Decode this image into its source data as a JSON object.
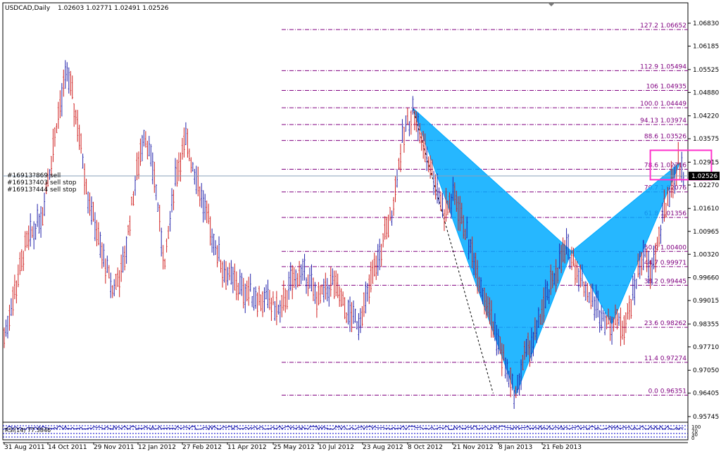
{
  "header": {
    "symbol_label": "USDCAD,Daily",
    "ohlc_text": "1.02603 1.02771 1.02491 1.02526"
  },
  "orders": [
    "#16913?869 sell",
    "#16913?403 sell stop",
    "#16913?444 sell stop"
  ],
  "indicator": {
    "label": "RSI(14) 77.3846",
    "level_labels": [
      "100",
      "70",
      "30",
      "0"
    ]
  },
  "colors": {
    "bull_bar": "#2222aa",
    "bear_bar": "#d02020",
    "pattern_fill": "#00aaff",
    "fib_line": "#800080",
    "target_box": "#ff33cc",
    "price_line": "#8aa0b8",
    "axis_line": "#000000",
    "indicator_line": "#1010a0",
    "indicator_dots": "#0000cc"
  },
  "chart_data": {
    "type": "candlestick",
    "instrument": "USDCAD",
    "timeframe": "Daily",
    "current_price": 1.02526,
    "ylim": [
      0.9545,
      1.0705
    ],
    "y_ticks": [
      "1.06830",
      "1.06185",
      "1.05525",
      "1.04880",
      "1.04220",
      "1.03575",
      "1.02915",
      "1.02270",
      "1.01610",
      "1.00965",
      "1.00320",
      "0.99660",
      "0.99015",
      "0.98355",
      "0.97710",
      "0.97050",
      "0.96405",
      "0.95745"
    ],
    "x_ticks": [
      "31 Aug 2011",
      "14 Oct 2011",
      "29 Nov 2011",
      "12 Jan 2012",
      "27 Feb 2012",
      "11 Apr 2012",
      "25 May 2012",
      "10 Jul 2012",
      "23 Aug 2012",
      "8 Oct 2012",
      "21 Nov 2012",
      "8 Jan 2013",
      "21 Feb 2013"
    ],
    "bar_count": 390,
    "price_path": [
      [
        0,
        0.98
      ],
      [
        12,
        1.005
      ],
      [
        22,
        1.015
      ],
      [
        30,
        1.04
      ],
      [
        36,
        1.055
      ],
      [
        42,
        1.04
      ],
      [
        48,
        1.02
      ],
      [
        55,
        1.005
      ],
      [
        62,
        0.993
      ],
      [
        68,
        0.999
      ],
      [
        74,
        1.02
      ],
      [
        80,
        1.038
      ],
      [
        86,
        1.025
      ],
      [
        92,
        1.0
      ],
      [
        98,
        1.025
      ],
      [
        104,
        1.035
      ],
      [
        110,
        1.025
      ],
      [
        118,
        1.01
      ],
      [
        126,
        0.998
      ],
      [
        134,
        0.994
      ],
      [
        142,
        0.992
      ],
      [
        150,
        0.99
      ],
      [
        158,
        0.987
      ],
      [
        165,
        0.996
      ],
      [
        172,
        0.998
      ],
      [
        180,
        0.99
      ],
      [
        188,
        0.995
      ],
      [
        196,
        0.987
      ],
      [
        203,
        0.984
      ],
      [
        210,
        0.995
      ],
      [
        216,
        1.005
      ],
      [
        222,
        1.015
      ],
      [
        228,
        1.035
      ],
      [
        234,
        1.0444
      ],
      [
        240,
        1.034
      ],
      [
        246,
        1.025
      ],
      [
        252,
        1.015
      ],
      [
        258,
        1.02
      ],
      [
        264,
        1.01
      ],
      [
        270,
        1.0
      ],
      [
        276,
        0.99
      ],
      [
        282,
        0.98
      ],
      [
        288,
        0.97
      ],
      [
        293,
        0.9635
      ],
      [
        298,
        0.975
      ],
      [
        304,
        0.98
      ],
      [
        310,
        0.99
      ],
      [
        316,
        0.998
      ],
      [
        322,
        1.005
      ],
      [
        328,
        0.999
      ],
      [
        334,
        0.993
      ],
      [
        340,
        0.988
      ],
      [
        346,
        0.984
      ],
      [
        350,
        0.985
      ],
      [
        354,
        0.983
      ],
      [
        358,
        0.988
      ],
      [
        362,
        0.996
      ],
      [
        366,
        1.005
      ],
      [
        370,
        0.997
      ],
      [
        374,
        1.005
      ],
      [
        378,
        1.015
      ],
      [
        382,
        1.023
      ],
      [
        386,
        1.029
      ],
      [
        389,
        1.0253
      ]
    ],
    "fibonacci_levels": [
      {
        "label": "127.2 1.06652",
        "level": 1.06652
      },
      {
        "label": "112.9 1.05494",
        "level": 1.05494
      },
      {
        "label": "106 1.04935",
        "level": 1.04935
      },
      {
        "label": "100.0 1.04449",
        "level": 1.04449
      },
      {
        "label": "94.13 1.03974",
        "level": 1.03974
      },
      {
        "label": "88.6 1.03526",
        "level": 1.03526
      },
      {
        "label": "78.6 1.02716",
        "level": 1.02716
      },
      {
        "label": "70.7 1.02076",
        "level": 1.02076
      },
      {
        "label": "61.8 1.01356",
        "level": 1.01356
      },
      {
        "label": "50.0 1.00400",
        "level": 1.004
      },
      {
        "label": "44.7 0.99971",
        "level": 0.99971
      },
      {
        "label": "38.2 0.99445",
        "level": 0.99445
      },
      {
        "label": "23.6 0.98262",
        "level": 0.98262
      },
      {
        "label": "11.4 0.97274",
        "level": 0.97274
      },
      {
        "label": "0.0 0.96351",
        "level": 0.96351
      }
    ],
    "pattern": {
      "name_shown": "",
      "points": [
        {
          "bar": 234,
          "price": 1.0444
        },
        {
          "bar": 293,
          "price": 0.9635
        },
        {
          "bar": 325,
          "price": 1.004
        },
        {
          "bar": 348,
          "price": 0.9835
        },
        {
          "bar": 387,
          "price": 1.029
        }
      ],
      "triangles": [
        [
          0,
          1,
          2
        ],
        [
          2,
          3,
          4
        ]
      ],
      "dashed_line": [
        {
          "bar": 234,
          "price": 1.0444
        },
        {
          "bar": 280,
          "price": 0.964
        }
      ]
    },
    "target_box": {
      "bar_from": 370,
      "bar_to": 405,
      "price_top": 1.0325,
      "price_bottom": 1.0242
    },
    "rsi_value": 77.3846
  }
}
